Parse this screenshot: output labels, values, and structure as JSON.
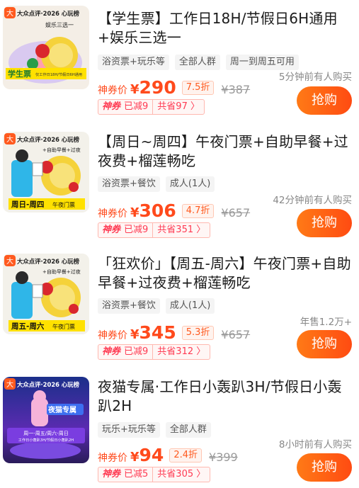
{
  "deals": [
    {
      "thumb": {
        "logo": "大众点评·2026 心玩榜",
        "badge": "娱乐三选一",
        "caption": "学生票",
        "sub": "仅工作日18H/节假日6H通用"
      },
      "title": "【学生票】工作日18H/节假日6H通用+娱乐三选一",
      "tags": [
        "浴资票+玩乐等",
        "全部人群",
        "周一到周五可用"
      ],
      "social": "5分钟前有人购买",
      "price_label": "神券价",
      "currency": "¥",
      "price": "290",
      "discount": "7.5折",
      "original": "¥387",
      "coupon": {
        "brand": "神券",
        "reduced": "已减9",
        "saved": "共省97 〉"
      },
      "buy_label": "抢购"
    },
    {
      "thumb": {
        "logo": "大众点评·2026 心玩榜",
        "badge": "+自助早餐+过夜",
        "caption": "周日-周四",
        "sub": "午夜门票"
      },
      "title": "【周日~周四】午夜门票+自助早餐+过夜费+榴莲畅吃",
      "tags": [
        "浴资票+餐饮",
        "成人(1人)"
      ],
      "social": "42分钟前有人购买",
      "price_label": "神券价",
      "currency": "¥",
      "price": "306",
      "discount": "4.7折",
      "original": "¥657",
      "coupon": {
        "brand": "神券",
        "reduced": "已减9",
        "saved": "共省351 〉"
      },
      "buy_label": "抢购"
    },
    {
      "thumb": {
        "logo": "大众点评·2026 心玩榜",
        "badge": "+自助早餐+过夜",
        "caption": "周五-周六",
        "sub": "午夜门票"
      },
      "title": "「狂欢价」【周五-周六】午夜门票+自助早餐+过夜费+榴莲畅吃",
      "tags": [
        "浴资票+餐饮",
        "成人(1人)"
      ],
      "social": "年售1.2万+",
      "price_label": "神券价",
      "currency": "¥",
      "price": "345",
      "discount": "5.3折",
      "original": "¥657",
      "coupon": {
        "brand": "神券",
        "reduced": "已减9",
        "saved": "共省312 〉"
      },
      "buy_label": "抢购"
    },
    {
      "thumb": {
        "logo": "大众点评·2026 心玩榜",
        "badge": "夜猫专属",
        "caption": "周一-周五/周六-周日",
        "sub": "工作日小轰趴3H/节假日小轰趴2H"
      },
      "title": "夜猫专属·工作日小轰趴3H/节假日小轰趴2H",
      "tags": [
        "玩乐+玩乐等",
        "全部人群"
      ],
      "social": "8小时前有人购买",
      "price_label": "神券价",
      "currency": "¥",
      "price": "94",
      "discount": "2.4折",
      "original": "¥399",
      "coupon": {
        "brand": "神券",
        "reduced": "已减5",
        "saved": "共省305 〉"
      },
      "buy_label": "抢购"
    }
  ],
  "colors": {
    "accent": "#ff4a1c",
    "buy_gradient_start": "#ff7a16",
    "buy_gradient_end": "#ff4b12",
    "coupon": "#ff3b53"
  }
}
